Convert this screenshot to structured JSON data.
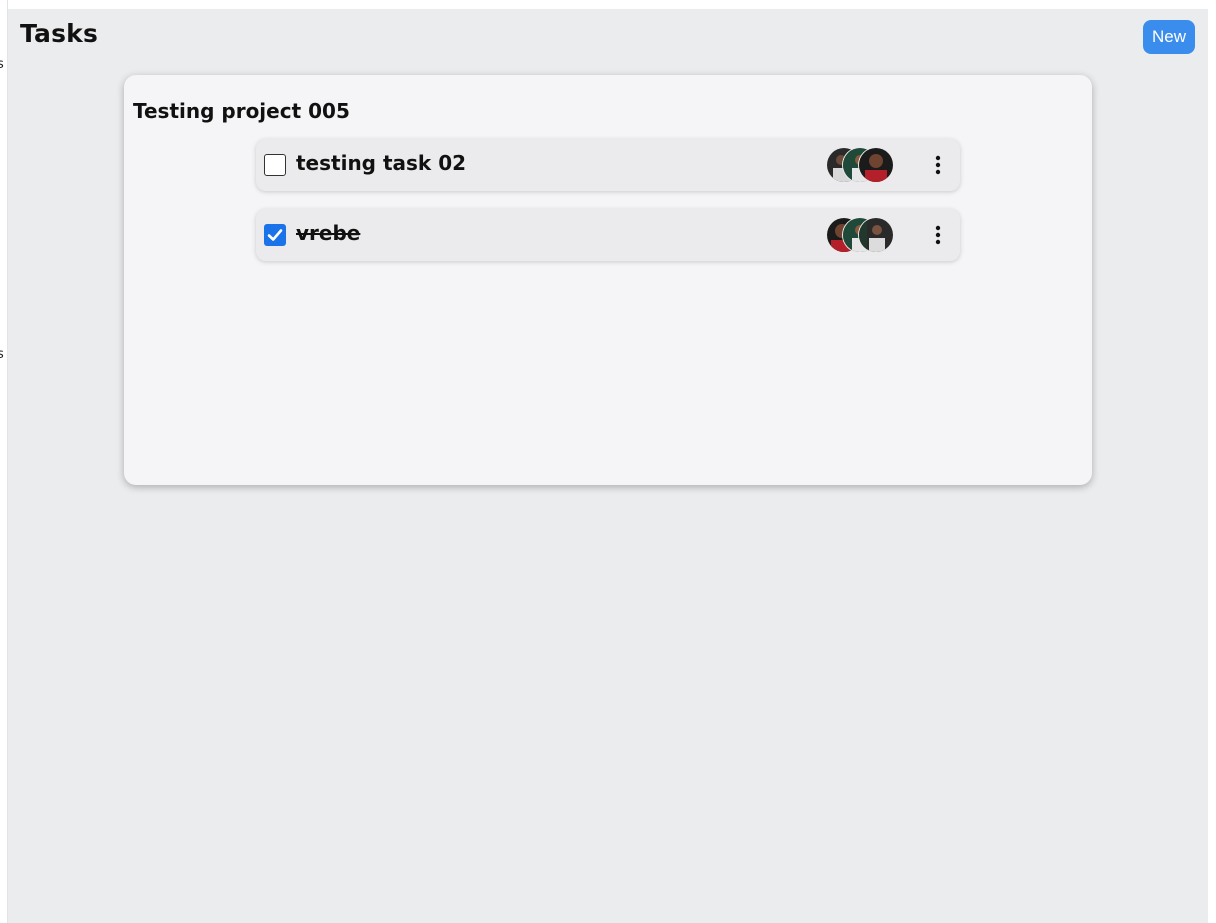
{
  "header": {
    "title": "Tasks",
    "new_label": "New"
  },
  "project": {
    "title": "Testing project 005",
    "tasks": [
      {
        "title": "testing task 02",
        "completed": false
      },
      {
        "title": "vrebe",
        "completed": true
      }
    ]
  },
  "colors": {
    "accent": "#3b8ded",
    "checkbox_checked": "#1a73e8",
    "page_background": "#ebecee",
    "card_background": "#f5f5f7",
    "task_background": "#ebebed"
  },
  "icons": {
    "menu": "kebab-menu-icon",
    "check": "checkmark-icon"
  }
}
